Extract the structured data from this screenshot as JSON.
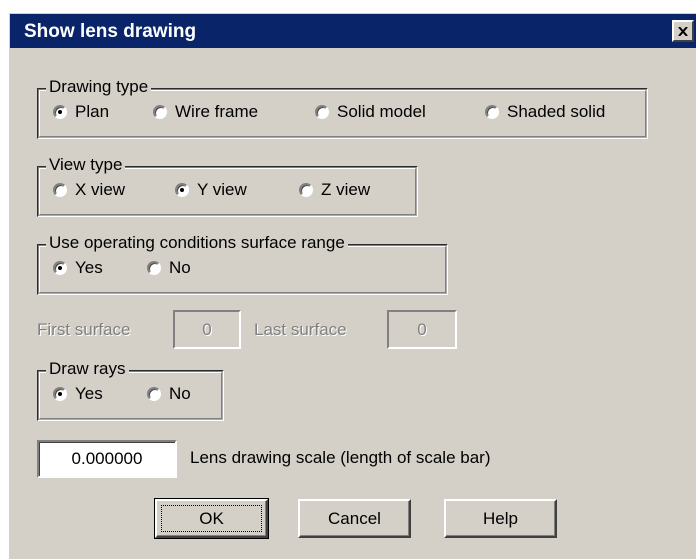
{
  "window": {
    "title": "Show lens drawing"
  },
  "drawing_type": {
    "legend": "Drawing type",
    "options": [
      "Plan",
      "Wire frame",
      "Solid model",
      "Shaded solid"
    ],
    "selected": "Plan"
  },
  "view_type": {
    "legend": "View type",
    "options": [
      "X view",
      "Y view",
      "Z view"
    ],
    "selected": "Y view"
  },
  "surface_range": {
    "legend": "Use operating conditions surface range",
    "options": [
      "Yes",
      "No"
    ],
    "selected": "Yes"
  },
  "surfaces": {
    "first_label": "First surface",
    "first_value": "0",
    "last_label": "Last surface",
    "last_value": "0"
  },
  "draw_rays": {
    "legend": "Draw rays",
    "options": [
      "Yes",
      "No"
    ],
    "selected": "Yes"
  },
  "scale": {
    "value": "0.000000",
    "label": "Lens drawing scale (length of scale bar)"
  },
  "buttons": {
    "ok": "OK",
    "cancel": "Cancel",
    "help": "Help"
  }
}
